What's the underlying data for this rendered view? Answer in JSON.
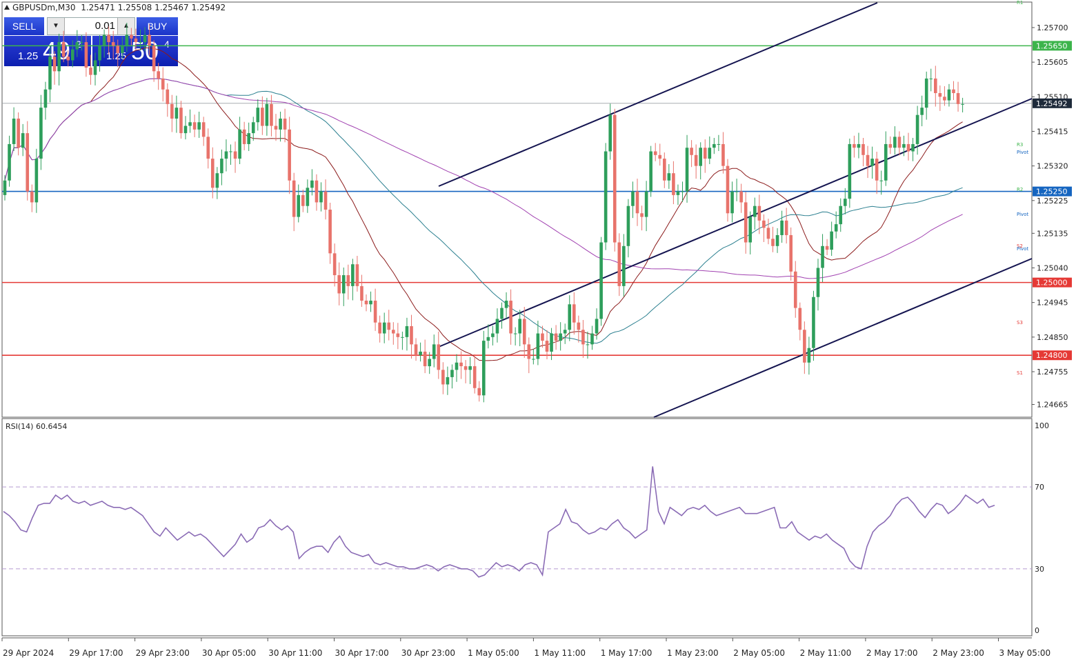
{
  "header": {
    "symbol": "GBPUSDm,M30",
    "ohlc": "1.25471 1.25508 1.25467 1.25492"
  },
  "trade_panel": {
    "sell_label": "SELL",
    "buy_label": "BUY",
    "lot_value": "0.01",
    "sell_price": {
      "small": "1.25",
      "big": "49",
      "sup": "2"
    },
    "buy_price": {
      "small": "1.25",
      "big": "50",
      "sup": "4"
    }
  },
  "colors": {
    "bull": "#2e9e5b",
    "bear": "#e8736b",
    "ma_fast": "#8b1a1a",
    "ma_mid": "#2a7f8f",
    "ma_slow": "#a040b0",
    "rsi": "#8a6bb5",
    "channel": "#141450",
    "level_green": "#3cb44b",
    "level_blue": "#1565c0",
    "level_red": "#e53935",
    "price_tag": "#1e2a3a"
  },
  "chart_data": [
    {
      "type": "candlestick",
      "x_ticks": [
        "29 Apr 2024",
        "29 Apr 17:00",
        "29 Apr 23:00",
        "30 Apr 05:00",
        "30 Apr 11:00",
        "30 Apr 17:00",
        "30 Apr 23:00",
        "1 May 05:00",
        "1 May 11:00",
        "1 May 17:00",
        "1 May 23:00",
        "2 May 05:00",
        "2 May 11:00",
        "2 May 17:00",
        "2 May 23:00",
        "3 May 05:00"
      ],
      "y_ticks": [
        "1.25700",
        "1.25605",
        "1.25510",
        "1.25415",
        "1.25320",
        "1.25225",
        "1.25135",
        "1.25040",
        "1.24945",
        "1.24850",
        "1.24755",
        "1.24665"
      ],
      "ylim": [
        1.2463,
        1.2577
      ],
      "current_price": "1.25492",
      "levels": [
        {
          "price": 1.2565,
          "label": "1.25650",
          "color": "green"
        },
        {
          "price": 1.2525,
          "label": "1.25250",
          "color": "blue"
        },
        {
          "price": 1.25,
          "label": "1.25000",
          "color": "red"
        },
        {
          "price": 1.248,
          "label": "1.24800",
          "color": "red"
        }
      ],
      "pivot_labels": [
        "R1",
        "R3",
        "Pivot",
        "R2",
        "Pivot",
        "S2",
        "Pivot",
        "S3",
        "S1"
      ],
      "closes": [
        1.2528,
        1.2538,
        1.2545,
        1.2537,
        1.2541,
        1.2525,
        1.2522,
        1.2534,
        1.2548,
        1.2553,
        1.2562,
        1.2558,
        1.2566,
        1.2562,
        1.2561,
        1.2564,
        1.2566,
        1.2566,
        1.2559,
        1.2557,
        1.2561,
        1.2565,
        1.2568,
        1.2566,
        1.2565,
        1.2563,
        1.2565,
        1.2568,
        1.2567,
        1.2566,
        1.2566,
        1.2568,
        1.2565,
        1.2558,
        1.2556,
        1.2553,
        1.2549,
        1.2545,
        1.2548,
        1.2541,
        1.2543,
        1.2544,
        1.2542,
        1.2544,
        1.254,
        1.2534,
        1.2526,
        1.253,
        1.2534,
        1.2536,
        1.2536,
        1.2534,
        1.2542,
        1.2538,
        1.2541,
        1.2544,
        1.2548,
        1.2543,
        1.2549,
        1.2543,
        1.2542,
        1.2545,
        1.2542,
        1.2528,
        1.2518,
        1.2524,
        1.2521,
        1.2526,
        1.2528,
        1.2522,
        1.2525,
        1.252,
        1.2508,
        1.2502,
        1.2497,
        1.2502,
        1.2499,
        1.2505,
        1.2499,
        1.2495,
        1.2494,
        1.2495,
        1.2489,
        1.2486,
        1.2489,
        1.2487,
        1.2486,
        1.2485,
        1.2485,
        1.2488,
        1.2483,
        1.248,
        1.2481,
        1.2477,
        1.2479,
        1.2483,
        1.2476,
        1.2472,
        1.2474,
        1.2476,
        1.2478,
        1.2477,
        1.2476,
        1.2477,
        1.2471,
        1.2469,
        1.2484,
        1.2485,
        1.2486,
        1.249,
        1.2493,
        1.2495,
        1.2486,
        1.2486,
        1.249,
        1.2483,
        1.2479,
        1.2479,
        1.2486,
        1.2484,
        1.2481,
        1.2486,
        1.2484,
        1.2486,
        1.2487,
        1.2494,
        1.2489,
        1.2487,
        1.2483,
        1.2483,
        1.2486,
        1.249,
        1.2511,
        1.2536,
        1.2546,
        1.2511,
        1.2499,
        1.251,
        1.2521,
        1.2525,
        1.2519,
        1.2518,
        1.2525,
        1.2536,
        1.2535,
        1.2534,
        1.2528,
        1.253,
        1.2524,
        1.2525,
        1.2525,
        1.2537,
        1.2535,
        1.2532,
        1.2537,
        1.2534,
        1.2537,
        1.2538,
        1.2538,
        1.2532,
        1.2519,
        1.2525,
        1.2525,
        1.2522,
        1.2511,
        1.2518,
        1.2521,
        1.2517,
        1.2515,
        1.2512,
        1.251,
        1.2513,
        1.2517,
        1.2513,
        1.2503,
        1.2493,
        1.2487,
        1.2478,
        1.2482,
        1.2496,
        1.2504,
        1.251,
        1.2509,
        1.2514,
        1.2516,
        1.2521,
        1.2523,
        1.2538,
        1.2537,
        1.2538,
        1.2535,
        1.2532,
        1.2534,
        1.2528,
        1.2528,
        1.2538,
        1.2537,
        1.254,
        1.2537,
        1.2538,
        1.2536,
        1.2538,
        1.2546,
        1.2548,
        1.2556,
        1.2556,
        1.2552,
        1.2551,
        1.255,
        1.2553,
        1.2552,
        1.2549,
        1.2549
      ]
    },
    {
      "type": "line",
      "title": "RSI(14) 60.6454",
      "y_ticks": [
        "100",
        "70",
        "30",
        "0"
      ],
      "ylim": [
        0,
        100
      ],
      "levels": [
        70,
        30
      ],
      "values": [
        58,
        56,
        53,
        49,
        48,
        55,
        61,
        62,
        62,
        66,
        64,
        66,
        63,
        62,
        63,
        61,
        62,
        63,
        61,
        60,
        60,
        59,
        60,
        58,
        56,
        52,
        48,
        46,
        50,
        47,
        44,
        46,
        48,
        46,
        47,
        45,
        42,
        39,
        36,
        39,
        42,
        47,
        43,
        45,
        50,
        51,
        54,
        51,
        49,
        51,
        48,
        35,
        38,
        40,
        41,
        41,
        38,
        43,
        46,
        41,
        38,
        37,
        36,
        37,
        33,
        32,
        33,
        32,
        31,
        31,
        30,
        30,
        31,
        32,
        31,
        29,
        31,
        32,
        31,
        30,
        30,
        29,
        26,
        27,
        30,
        33,
        31,
        32,
        31,
        29,
        32,
        33,
        32,
        27,
        48,
        50,
        52,
        59,
        53,
        52,
        49,
        47,
        48,
        50,
        49,
        52,
        54,
        50,
        48,
        45,
        47,
        49,
        80,
        58,
        52,
        60,
        58,
        56,
        59,
        60,
        59,
        61,
        58,
        56,
        57,
        58,
        59,
        60,
        57,
        57,
        57,
        58,
        59,
        60,
        50,
        50,
        53,
        48,
        46,
        44,
        46,
        45,
        47,
        44,
        42,
        40,
        34,
        31,
        30,
        41,
        48,
        51,
        53,
        56,
        61,
        64,
        65,
        62,
        58,
        55,
        59,
        62,
        61,
        57,
        59,
        62,
        66,
        64,
        62,
        64,
        60,
        61
      ]
    }
  ]
}
